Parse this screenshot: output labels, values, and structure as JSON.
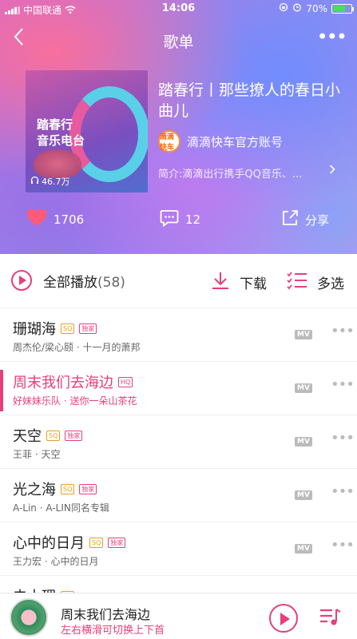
{
  "status_bar": {
    "carrier": "中国联通",
    "time": "14:06",
    "battery": "70%",
    "battery_level": 0.7
  },
  "nav": {
    "back_icon": "chevron-left-icon",
    "title": "歌单",
    "more_label": "•••"
  },
  "playlist": {
    "cover_text_line1": "踏春行",
    "cover_text_line2": "音乐电台",
    "play_count": "46.7万",
    "title": "踏春行丨那些撩人的春日小曲儿",
    "owner_avatar_text": "滴滴快车",
    "owner": "滴滴快车官方账号",
    "intro": "简介:滴滴出行携手QQ音乐、..."
  },
  "actions": {
    "like_count": "1706",
    "comment_count": "12",
    "share_label": "分享"
  },
  "toolbar": {
    "play_all_label": "全部播放",
    "song_count": "(58)",
    "download_label": "下载",
    "multi_select_label": "多选"
  },
  "songs": [
    {
      "title": "珊瑚海",
      "tags": [
        "SQ",
        "独家"
      ],
      "artist": "周杰伦/梁心颐",
      "album": "十一月的萧邦",
      "mv": "MV",
      "active": false
    },
    {
      "title": "周末我们去海边",
      "tags": [
        "HQ"
      ],
      "artist": "好妹妹乐队",
      "album": "送你一朵山茶花",
      "mv": "MV",
      "active": true
    },
    {
      "title": "天空",
      "tags": [
        "SQ",
        "独家"
      ],
      "artist": "王菲",
      "album": "天空",
      "mv": "MV",
      "active": false
    },
    {
      "title": "光之海",
      "tags": [
        "SQ",
        "独家"
      ],
      "artist": "A-Lin",
      "album": "A-LIN同名专辑",
      "mv": "MV",
      "active": false
    },
    {
      "title": "心中的日月",
      "tags": [
        "SQ",
        "独家"
      ],
      "artist": "王力宏",
      "album": "心中的日月",
      "mv": "MV",
      "active": false
    },
    {
      "title": "去大理",
      "tags": [
        "SQ"
      ],
      "artist": "",
      "album": "",
      "mv": "",
      "active": false
    }
  ],
  "mini_player": {
    "title": "周末我们去海边",
    "hint": "左右横滑可切换上下首"
  },
  "colors": {
    "accent": "#e83e7a"
  }
}
